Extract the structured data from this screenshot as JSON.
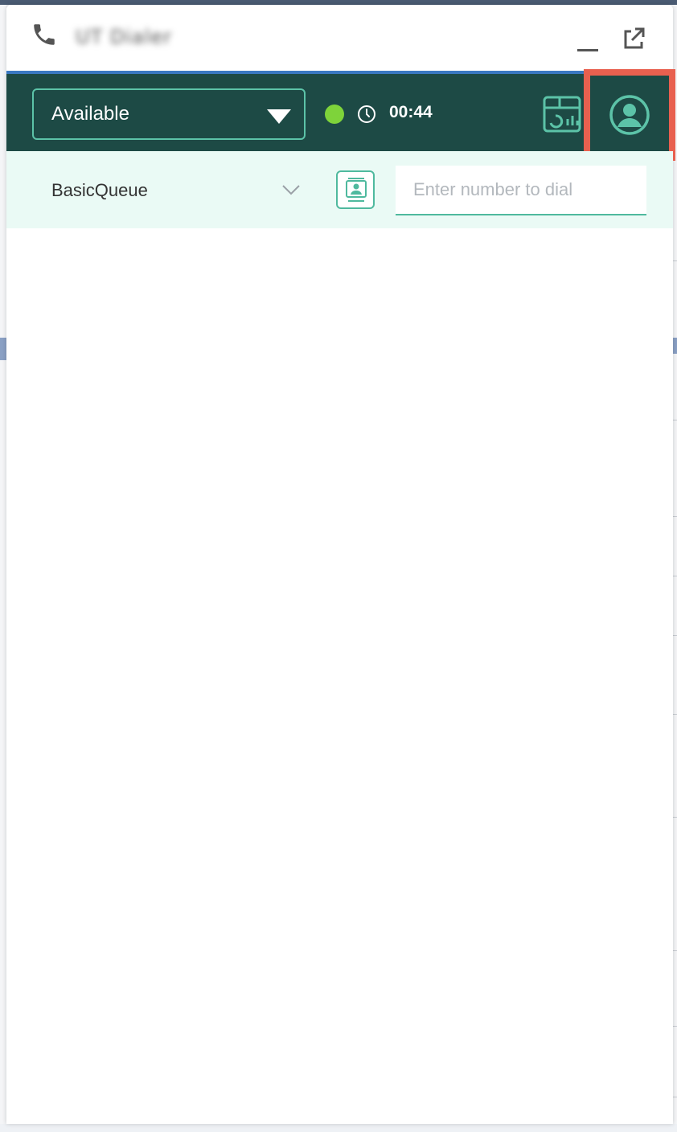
{
  "window": {
    "title": "UT Dialer",
    "title_blurred": true
  },
  "status": {
    "selected": "Available",
    "indicator_color": "#7ed33a",
    "timer": "00:44"
  },
  "dial": {
    "queue": "BasicQueue",
    "number_placeholder": "Enter number to dial",
    "number_value": ""
  },
  "icons": {
    "phone": "phone-icon",
    "minimize": "minimize-icon",
    "popout": "external-link-icon",
    "dropdown": "caret-down-icon",
    "clock": "clock-icon",
    "dashboard": "dashboard-chart-icon",
    "profile": "user-profile-icon",
    "queue_chevron": "chevron-down-icon",
    "contacts": "contact-card-icon"
  },
  "colors": {
    "header_bg": "#1d4a45",
    "accent": "#5cc3a8",
    "highlight_border": "#e8604f",
    "dial_bar_bg": "#eafaf5",
    "top_border": "#3a78c2"
  }
}
